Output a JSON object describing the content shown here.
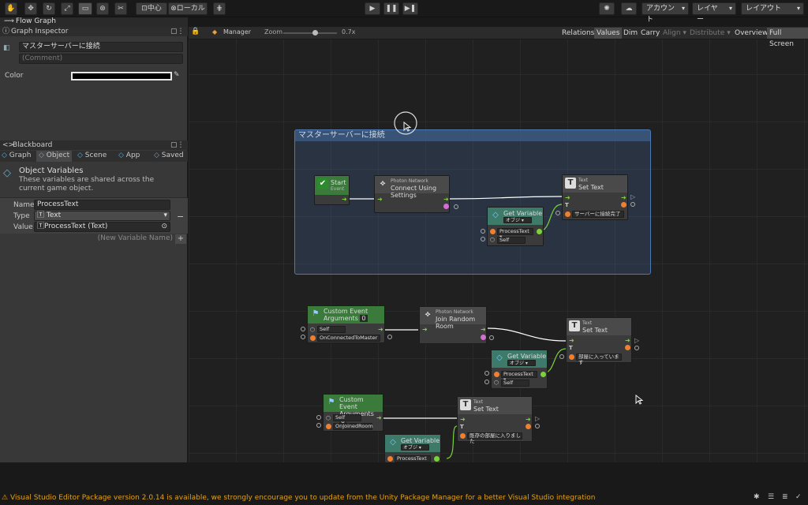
{
  "toolbar": {
    "center_label": "中心",
    "local_label": "ローカル",
    "account": "アカウント",
    "layers": "レイヤー",
    "layout": "レイアウト"
  },
  "window": {
    "title": "Flow Graph"
  },
  "inspector": {
    "title": "Graph Inspector",
    "node_title": "マスターサーバーに接続",
    "comment_placeholder": "(Comment)",
    "color_label": "Color"
  },
  "blackboard": {
    "title": "Blackboard",
    "tabs": [
      "Graph",
      "Object",
      "Scene",
      "App",
      "Saved"
    ],
    "heading": "Object Variables",
    "desc": "These variables are shared across the current game object.",
    "name_label": "Name",
    "name_value": "ProcessText",
    "type_label": "Type",
    "type_value": "Text",
    "value_label": "Value",
    "value_value": "ProcessText (Text)",
    "new_var_placeholder": "(New Variable Name)"
  },
  "graph_toolbar": {
    "manager": "Manager",
    "zoom_label": "Zoom",
    "zoom_value": "0.7x",
    "zoom_fraction": 0.55,
    "buttons": [
      "Relations",
      "Values",
      "Dim",
      "Carry",
      "Align ▾",
      "Distribute ▾",
      "Overview",
      "Full Screen"
    ]
  },
  "group": {
    "title": "マスターサーバーに接続"
  },
  "nodes": {
    "start": {
      "title": "Start",
      "sub": "Event"
    },
    "connect": {
      "sub": "Photon Network",
      "title": "Connect Using Settings"
    },
    "settext1": {
      "sub": "Text",
      "title": "Set Text",
      "value": "サーバーに接続完了"
    },
    "getvar1": {
      "title": "Get Variable",
      "scope": "オブジ ▾",
      "var": "ProcessText ▾",
      "self": "Self"
    },
    "custom1": {
      "title": "Custom Event",
      "args": "Arguments",
      "argcount": "0",
      "self": "Self",
      "name": "OnConnectedToMaster"
    },
    "join": {
      "sub": "Photon Network",
      "title": "Join Random Room"
    },
    "settext2": {
      "sub": "Text",
      "title": "Set Text",
      "value": "部屋に入っています"
    },
    "getvar2": {
      "title": "Get Variable",
      "scope": "オブジ ▾",
      "var": "ProcessText ▾",
      "self": "Self"
    },
    "custom2": {
      "title": "Custom Event",
      "args": "Arguments",
      "argcount": "0",
      "self": "Self",
      "name": "OnJoinedRoom"
    },
    "settext3": {
      "sub": "Text",
      "title": "Set Text",
      "value": "既存の部屋に入りました"
    },
    "getvar3": {
      "title": "Get Variable",
      "scope": "オブジ ▾",
      "var": "ProcessText ▾"
    }
  },
  "status": {
    "message": "Visual Studio Editor Package version 2.0.14 is available, we strongly encourage you to update from the Unity Package Manager for a better Visual Studio integration",
    "color": "#e0a21a"
  }
}
